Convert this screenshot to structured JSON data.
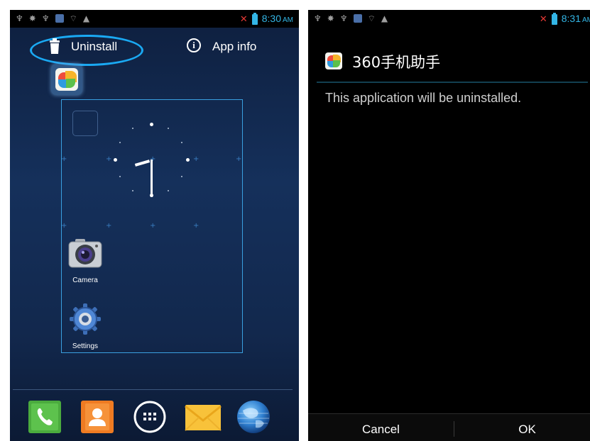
{
  "left_screen": {
    "status_bar": {
      "icons": [
        "usb-icon",
        "android-debug-icon",
        "usb-icon",
        "notification-app-icon",
        "wifi-icon",
        "warning-icon"
      ],
      "time": "8:30",
      "time_suffix": "AM"
    },
    "drop_targets": {
      "uninstall_label": "Uninstall",
      "app_info_label": "App info",
      "highlight_color": "#1aa9f3"
    },
    "dragged_app": "360-app-icon",
    "apps": [
      {
        "label": "Camera",
        "icon": "camera-icon"
      },
      {
        "label": "Settings",
        "icon": "settings-icon"
      }
    ],
    "dock": [
      "phone-icon",
      "contacts-icon",
      "app-drawer-icon",
      "email-icon",
      "browser-icon"
    ]
  },
  "right_screen": {
    "status_bar": {
      "time": "8:31",
      "time_suffix": "AM"
    },
    "dialog": {
      "title": "360手机助手",
      "message": "This application will be uninstalled.",
      "cancel_label": "Cancel",
      "ok_label": "OK"
    }
  },
  "colors": {
    "accent": "#33b5e5",
    "background_left": "#12284d",
    "background_right": "#000000"
  }
}
